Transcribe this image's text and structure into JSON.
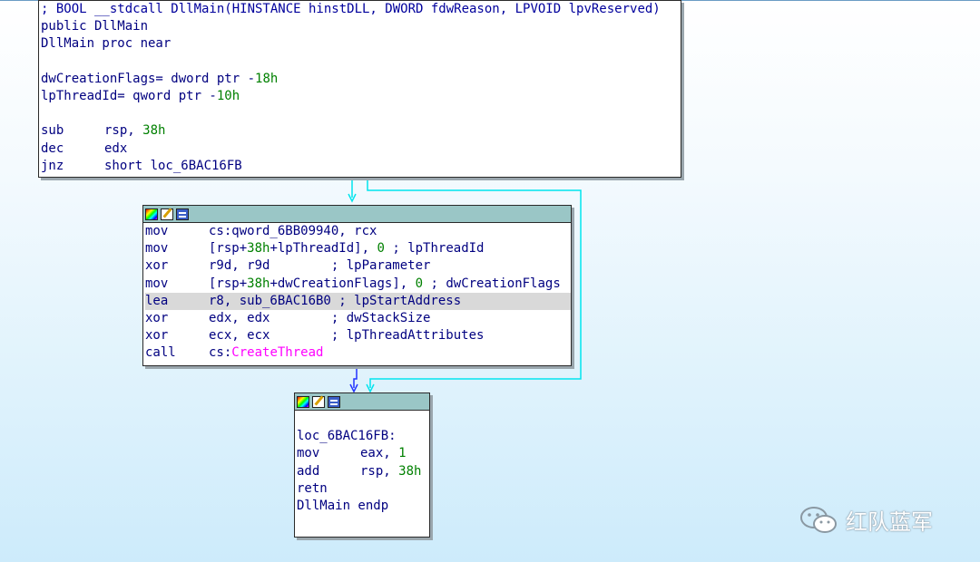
{
  "block1": {
    "lines": [
      {
        "html": "<span class='t-com'>; BOOL __stdcall DllMain(HINSTANCE hinstDLL, DWORD fdwReason, LPVOID lpvReserved)</span>"
      },
      {
        "html": "public DllMain"
      },
      {
        "html": "DllMain proc near"
      },
      {
        "html": ""
      },
      {
        "html": "dwCreationFlags= dword ptr -<span class='t-num'>18h</span>"
      },
      {
        "html": "lpThreadId= qword ptr -<span class='t-num'>10h</span>"
      },
      {
        "html": ""
      },
      {
        "html": "<span class='c1'>sub</span>rsp, <span class='t-num'>38h</span>"
      },
      {
        "html": "<span class='c1'>dec</span>edx"
      },
      {
        "html": "<span class='c1'>jnz</span>short loc_6BAC16FB"
      }
    ]
  },
  "block2": {
    "lines": [
      {
        "html": "<span class='c1'>mov</span>cs:qword_6BB09940, rcx"
      },
      {
        "html": "<span class='c1'>mov</span>[rsp+<span class='t-num'>38h</span>+lpThreadId], <span class='t-num'>0</span> ; lpThreadId"
      },
      {
        "html": "<span class='c1'>xor</span>r9d, r9d        ; lpParameter"
      },
      {
        "html": "<span class='c1'>mov</span>[rsp+<span class='t-num'>38h</span>+dwCreationFlags], <span class='t-num'>0</span> ; dwCreationFlags"
      },
      {
        "html": "<span class='c1'>lea</span>r8, sub_6BAC16B0 ; lpStartAddress",
        "hl": true
      },
      {
        "html": "<span class='c1'>xor</span>edx, edx        ; dwStackSize"
      },
      {
        "html": "<span class='c1'>xor</span>ecx, ecx        ; lpThreadAttributes"
      },
      {
        "html": "<span class='c1'>call</span>cs:<span class='t-imp'>CreateThread</span>"
      }
    ]
  },
  "block3": {
    "lines": [
      {
        "html": ""
      },
      {
        "html": "loc_6BAC16FB:"
      },
      {
        "html": "<span class='c1'>mov</span>eax, <span class='t-num'>1</span>"
      },
      {
        "html": "<span class='c1'>add</span>rsp, <span class='t-num'>38h</span>"
      },
      {
        "html": "retn"
      },
      {
        "html": "DllMain endp"
      }
    ]
  },
  "watermark": {
    "text": "红队蓝军",
    "icon": "wechat-icon"
  },
  "colors": {
    "edge_false": "#00e5ee",
    "edge_true": "#2233ff",
    "header": "#9ac6c6"
  }
}
